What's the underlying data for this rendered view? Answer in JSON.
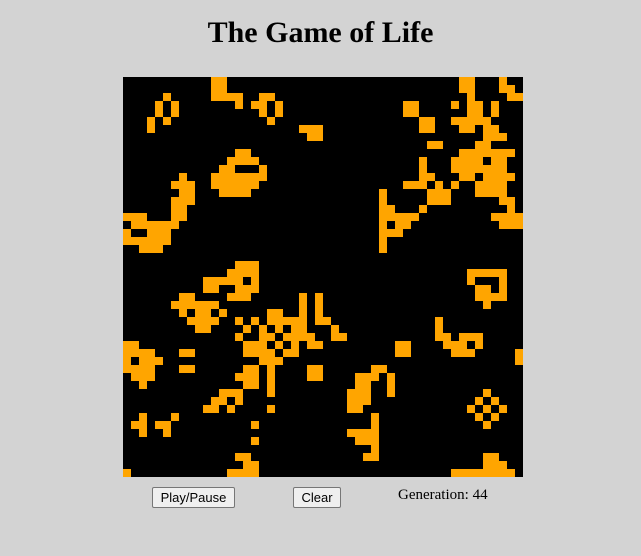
{
  "title": "The Game of Life",
  "controls": {
    "play_pause_label": "Play/Pause",
    "clear_label": "Clear"
  },
  "generation": {
    "label": "Generation:",
    "value": "44"
  },
  "colors": {
    "page_background": "#d3d3d3",
    "board_background": "#000000",
    "live_cell": "#ffa500"
  },
  "grid": {
    "cols": 50,
    "rows": 50,
    "live_cells": [
      [
        11,
        0
      ],
      [
        12,
        0
      ],
      [
        42,
        0
      ],
      [
        43,
        0
      ],
      [
        47,
        0
      ],
      [
        11,
        1
      ],
      [
        12,
        1
      ],
      [
        42,
        1
      ],
      [
        43,
        1
      ],
      [
        47,
        1
      ],
      [
        48,
        1
      ],
      [
        5,
        2
      ],
      [
        11,
        2
      ],
      [
        12,
        2
      ],
      [
        13,
        2
      ],
      [
        14,
        2
      ],
      [
        17,
        2
      ],
      [
        18,
        2
      ],
      [
        43,
        2
      ],
      [
        48,
        2
      ],
      [
        49,
        2
      ],
      [
        4,
        3
      ],
      [
        6,
        3
      ],
      [
        14,
        3
      ],
      [
        16,
        3
      ],
      [
        17,
        3
      ],
      [
        19,
        3
      ],
      [
        35,
        3
      ],
      [
        36,
        3
      ],
      [
        41,
        3
      ],
      [
        43,
        3
      ],
      [
        44,
        3
      ],
      [
        46,
        3
      ],
      [
        4,
        4
      ],
      [
        6,
        4
      ],
      [
        17,
        4
      ],
      [
        19,
        4
      ],
      [
        35,
        4
      ],
      [
        36,
        4
      ],
      [
        43,
        4
      ],
      [
        44,
        4
      ],
      [
        46,
        4
      ],
      [
        3,
        5
      ],
      [
        5,
        5
      ],
      [
        18,
        5
      ],
      [
        37,
        5
      ],
      [
        38,
        5
      ],
      [
        41,
        5
      ],
      [
        42,
        5
      ],
      [
        43,
        5
      ],
      [
        44,
        5
      ],
      [
        45,
        5
      ],
      [
        3,
        6
      ],
      [
        22,
        6
      ],
      [
        23,
        6
      ],
      [
        24,
        6
      ],
      [
        37,
        6
      ],
      [
        38,
        6
      ],
      [
        42,
        6
      ],
      [
        43,
        6
      ],
      [
        45,
        6
      ],
      [
        46,
        6
      ],
      [
        23,
        7
      ],
      [
        24,
        7
      ],
      [
        45,
        7
      ],
      [
        46,
        7
      ],
      [
        47,
        7
      ],
      [
        38,
        8
      ],
      [
        39,
        8
      ],
      [
        44,
        8
      ],
      [
        45,
        8
      ],
      [
        14,
        9
      ],
      [
        15,
        9
      ],
      [
        42,
        9
      ],
      [
        43,
        9
      ],
      [
        44,
        9
      ],
      [
        45,
        9
      ],
      [
        46,
        9
      ],
      [
        47,
        9
      ],
      [
        48,
        9
      ],
      [
        13,
        10
      ],
      [
        14,
        10
      ],
      [
        15,
        10
      ],
      [
        16,
        10
      ],
      [
        37,
        10
      ],
      [
        41,
        10
      ],
      [
        42,
        10
      ],
      [
        43,
        10
      ],
      [
        44,
        10
      ],
      [
        46,
        10
      ],
      [
        47,
        10
      ],
      [
        12,
        11
      ],
      [
        13,
        11
      ],
      [
        17,
        11
      ],
      [
        37,
        11
      ],
      [
        41,
        11
      ],
      [
        42,
        11
      ],
      [
        43,
        11
      ],
      [
        44,
        11
      ],
      [
        45,
        11
      ],
      [
        46,
        11
      ],
      [
        47,
        11
      ],
      [
        7,
        12
      ],
      [
        11,
        12
      ],
      [
        12,
        12
      ],
      [
        13,
        12
      ],
      [
        14,
        12
      ],
      [
        15,
        12
      ],
      [
        16,
        12
      ],
      [
        17,
        12
      ],
      [
        37,
        12
      ],
      [
        38,
        12
      ],
      [
        42,
        12
      ],
      [
        43,
        12
      ],
      [
        45,
        12
      ],
      [
        46,
        12
      ],
      [
        47,
        12
      ],
      [
        48,
        12
      ],
      [
        6,
        13
      ],
      [
        7,
        13
      ],
      [
        8,
        13
      ],
      [
        11,
        13
      ],
      [
        12,
        13
      ],
      [
        13,
        13
      ],
      [
        14,
        13
      ],
      [
        15,
        13
      ],
      [
        16,
        13
      ],
      [
        35,
        13
      ],
      [
        36,
        13
      ],
      [
        37,
        13
      ],
      [
        39,
        13
      ],
      [
        41,
        13
      ],
      [
        44,
        13
      ],
      [
        45,
        13
      ],
      [
        46,
        13
      ],
      [
        47,
        13
      ],
      [
        7,
        14
      ],
      [
        8,
        14
      ],
      [
        12,
        14
      ],
      [
        13,
        14
      ],
      [
        14,
        14
      ],
      [
        15,
        14
      ],
      [
        32,
        14
      ],
      [
        38,
        14
      ],
      [
        39,
        14
      ],
      [
        40,
        14
      ],
      [
        44,
        14
      ],
      [
        45,
        14
      ],
      [
        46,
        14
      ],
      [
        47,
        14
      ],
      [
        6,
        15
      ],
      [
        7,
        15
      ],
      [
        8,
        15
      ],
      [
        32,
        15
      ],
      [
        38,
        15
      ],
      [
        39,
        15
      ],
      [
        40,
        15
      ],
      [
        47,
        15
      ],
      [
        48,
        15
      ],
      [
        6,
        16
      ],
      [
        7,
        16
      ],
      [
        32,
        16
      ],
      [
        33,
        16
      ],
      [
        37,
        16
      ],
      [
        48,
        16
      ],
      [
        0,
        17
      ],
      [
        1,
        17
      ],
      [
        2,
        17
      ],
      [
        6,
        17
      ],
      [
        7,
        17
      ],
      [
        32,
        17
      ],
      [
        33,
        17
      ],
      [
        34,
        17
      ],
      [
        35,
        17
      ],
      [
        36,
        17
      ],
      [
        46,
        17
      ],
      [
        47,
        17
      ],
      [
        48,
        17
      ],
      [
        49,
        17
      ],
      [
        1,
        18
      ],
      [
        2,
        18
      ],
      [
        3,
        18
      ],
      [
        4,
        18
      ],
      [
        5,
        18
      ],
      [
        6,
        18
      ],
      [
        32,
        18
      ],
      [
        34,
        18
      ],
      [
        35,
        18
      ],
      [
        47,
        18
      ],
      [
        48,
        18
      ],
      [
        49,
        18
      ],
      [
        0,
        19
      ],
      [
        3,
        19
      ],
      [
        4,
        19
      ],
      [
        5,
        19
      ],
      [
        32,
        19
      ],
      [
        33,
        19
      ],
      [
        34,
        19
      ],
      [
        0,
        20
      ],
      [
        1,
        20
      ],
      [
        2,
        20
      ],
      [
        3,
        20
      ],
      [
        4,
        20
      ],
      [
        5,
        20
      ],
      [
        32,
        20
      ],
      [
        2,
        21
      ],
      [
        3,
        21
      ],
      [
        4,
        21
      ],
      [
        32,
        21
      ],
      [
        14,
        23
      ],
      [
        15,
        23
      ],
      [
        16,
        23
      ],
      [
        13,
        24
      ],
      [
        14,
        24
      ],
      [
        15,
        24
      ],
      [
        16,
        24
      ],
      [
        43,
        24
      ],
      [
        44,
        24
      ],
      [
        45,
        24
      ],
      [
        46,
        24
      ],
      [
        47,
        24
      ],
      [
        10,
        25
      ],
      [
        11,
        25
      ],
      [
        12,
        25
      ],
      [
        13,
        25
      ],
      [
        14,
        25
      ],
      [
        16,
        25
      ],
      [
        43,
        25
      ],
      [
        47,
        25
      ],
      [
        10,
        26
      ],
      [
        11,
        26
      ],
      [
        14,
        26
      ],
      [
        15,
        26
      ],
      [
        16,
        26
      ],
      [
        44,
        26
      ],
      [
        45,
        26
      ],
      [
        47,
        26
      ],
      [
        7,
        27
      ],
      [
        8,
        27
      ],
      [
        13,
        27
      ],
      [
        14,
        27
      ],
      [
        15,
        27
      ],
      [
        22,
        27
      ],
      [
        24,
        27
      ],
      [
        44,
        27
      ],
      [
        45,
        27
      ],
      [
        46,
        27
      ],
      [
        47,
        27
      ],
      [
        6,
        28
      ],
      [
        7,
        28
      ],
      [
        8,
        28
      ],
      [
        9,
        28
      ],
      [
        10,
        28
      ],
      [
        11,
        28
      ],
      [
        22,
        28
      ],
      [
        24,
        28
      ],
      [
        45,
        28
      ],
      [
        7,
        29
      ],
      [
        9,
        29
      ],
      [
        10,
        29
      ],
      [
        12,
        29
      ],
      [
        18,
        29
      ],
      [
        19,
        29
      ],
      [
        22,
        29
      ],
      [
        24,
        29
      ],
      [
        8,
        30
      ],
      [
        9,
        30
      ],
      [
        10,
        30
      ],
      [
        11,
        30
      ],
      [
        14,
        30
      ],
      [
        16,
        30
      ],
      [
        18,
        30
      ],
      [
        19,
        30
      ],
      [
        20,
        30
      ],
      [
        21,
        30
      ],
      [
        22,
        30
      ],
      [
        24,
        30
      ],
      [
        25,
        30
      ],
      [
        39,
        30
      ],
      [
        9,
        31
      ],
      [
        10,
        31
      ],
      [
        15,
        31
      ],
      [
        17,
        31
      ],
      [
        19,
        31
      ],
      [
        21,
        31
      ],
      [
        22,
        31
      ],
      [
        26,
        31
      ],
      [
        39,
        31
      ],
      [
        14,
        32
      ],
      [
        17,
        32
      ],
      [
        18,
        32
      ],
      [
        20,
        32
      ],
      [
        21,
        32
      ],
      [
        22,
        32
      ],
      [
        23,
        32
      ],
      [
        26,
        32
      ],
      [
        27,
        32
      ],
      [
        39,
        32
      ],
      [
        40,
        32
      ],
      [
        42,
        32
      ],
      [
        43,
        32
      ],
      [
        44,
        32
      ],
      [
        0,
        33
      ],
      [
        1,
        33
      ],
      [
        15,
        33
      ],
      [
        16,
        33
      ],
      [
        17,
        33
      ],
      [
        19,
        33
      ],
      [
        21,
        33
      ],
      [
        23,
        33
      ],
      [
        24,
        33
      ],
      [
        34,
        33
      ],
      [
        35,
        33
      ],
      [
        40,
        33
      ],
      [
        41,
        33
      ],
      [
        42,
        33
      ],
      [
        44,
        33
      ],
      [
        0,
        34
      ],
      [
        1,
        34
      ],
      [
        2,
        34
      ],
      [
        3,
        34
      ],
      [
        7,
        34
      ],
      [
        8,
        34
      ],
      [
        15,
        34
      ],
      [
        16,
        34
      ],
      [
        17,
        34
      ],
      [
        18,
        34
      ],
      [
        20,
        34
      ],
      [
        21,
        34
      ],
      [
        34,
        34
      ],
      [
        35,
        34
      ],
      [
        41,
        34
      ],
      [
        42,
        34
      ],
      [
        43,
        34
      ],
      [
        49,
        34
      ],
      [
        0,
        35
      ],
      [
        2,
        35
      ],
      [
        3,
        35
      ],
      [
        4,
        35
      ],
      [
        17,
        35
      ],
      [
        18,
        35
      ],
      [
        19,
        35
      ],
      [
        49,
        35
      ],
      [
        0,
        36
      ],
      [
        1,
        36
      ],
      [
        2,
        36
      ],
      [
        3,
        36
      ],
      [
        7,
        36
      ],
      [
        8,
        36
      ],
      [
        15,
        36
      ],
      [
        16,
        36
      ],
      [
        18,
        36
      ],
      [
        23,
        36
      ],
      [
        24,
        36
      ],
      [
        31,
        36
      ],
      [
        32,
        36
      ],
      [
        1,
        37
      ],
      [
        2,
        37
      ],
      [
        3,
        37
      ],
      [
        14,
        37
      ],
      [
        15,
        37
      ],
      [
        16,
        37
      ],
      [
        18,
        37
      ],
      [
        23,
        37
      ],
      [
        24,
        37
      ],
      [
        29,
        37
      ],
      [
        30,
        37
      ],
      [
        31,
        37
      ],
      [
        33,
        37
      ],
      [
        2,
        38
      ],
      [
        15,
        38
      ],
      [
        16,
        38
      ],
      [
        18,
        38
      ],
      [
        29,
        38
      ],
      [
        30,
        38
      ],
      [
        33,
        38
      ],
      [
        12,
        39
      ],
      [
        13,
        39
      ],
      [
        14,
        39
      ],
      [
        18,
        39
      ],
      [
        28,
        39
      ],
      [
        29,
        39
      ],
      [
        30,
        39
      ],
      [
        33,
        39
      ],
      [
        45,
        39
      ],
      [
        11,
        40
      ],
      [
        12,
        40
      ],
      [
        14,
        40
      ],
      [
        28,
        40
      ],
      [
        29,
        40
      ],
      [
        30,
        40
      ],
      [
        44,
        40
      ],
      [
        46,
        40
      ],
      [
        10,
        41
      ],
      [
        11,
        41
      ],
      [
        13,
        41
      ],
      [
        18,
        41
      ],
      [
        28,
        41
      ],
      [
        29,
        41
      ],
      [
        43,
        41
      ],
      [
        45,
        41
      ],
      [
        47,
        41
      ],
      [
        2,
        42
      ],
      [
        6,
        42
      ],
      [
        31,
        42
      ],
      [
        44,
        42
      ],
      [
        46,
        42
      ],
      [
        1,
        43
      ],
      [
        2,
        43
      ],
      [
        4,
        43
      ],
      [
        5,
        43
      ],
      [
        16,
        43
      ],
      [
        31,
        43
      ],
      [
        45,
        43
      ],
      [
        2,
        44
      ],
      [
        5,
        44
      ],
      [
        28,
        44
      ],
      [
        29,
        44
      ],
      [
        30,
        44
      ],
      [
        31,
        44
      ],
      [
        16,
        45
      ],
      [
        29,
        45
      ],
      [
        30,
        45
      ],
      [
        31,
        45
      ],
      [
        31,
        46
      ],
      [
        14,
        47
      ],
      [
        15,
        47
      ],
      [
        30,
        47
      ],
      [
        31,
        47
      ],
      [
        45,
        47
      ],
      [
        46,
        47
      ],
      [
        15,
        48
      ],
      [
        16,
        48
      ],
      [
        45,
        48
      ],
      [
        46,
        48
      ],
      [
        47,
        48
      ],
      [
        0,
        49
      ],
      [
        13,
        49
      ],
      [
        14,
        49
      ],
      [
        15,
        49
      ],
      [
        16,
        49
      ],
      [
        41,
        49
      ],
      [
        42,
        49
      ],
      [
        43,
        49
      ],
      [
        44,
        49
      ],
      [
        45,
        49
      ],
      [
        46,
        49
      ],
      [
        47,
        49
      ],
      [
        48,
        49
      ]
    ]
  }
}
